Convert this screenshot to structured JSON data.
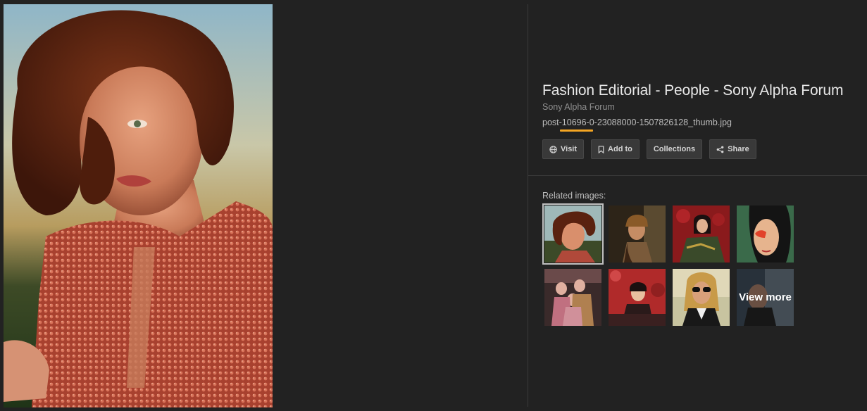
{
  "result": {
    "title": "Fashion Editorial - People - Sony Alpha Forum",
    "source": "Sony Alpha Forum",
    "filename": "post-10696-0-23088000-1507826128_thumb.jpg"
  },
  "actions": {
    "visit": {
      "label": "Visit",
      "icon": "globe-icon"
    },
    "add_to": {
      "label": "Add to",
      "icon": "bookmark-icon"
    },
    "collections": {
      "label": "Collections"
    },
    "share": {
      "label": "Share",
      "icon": "share-icon"
    }
  },
  "related": {
    "label": "Related images:",
    "view_more_label": "View more"
  },
  "colors": {
    "background": "#222222",
    "button_bg": "#393939",
    "highlight_underline": "#f5a623"
  }
}
